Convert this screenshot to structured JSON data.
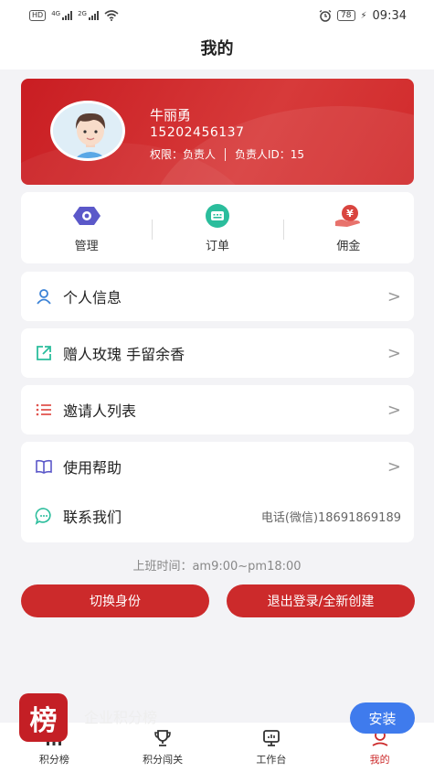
{
  "status_bar": {
    "left_badge": "HD",
    "net1": "4G",
    "net2": "2G",
    "battery": "78",
    "time": "09:34"
  },
  "navbar": {
    "title": "我的"
  },
  "profile": {
    "name": "牛丽勇",
    "phone": "15202456137",
    "permission": "权限：负责人",
    "manager_id": "负责人ID：15"
  },
  "quick_actions": [
    {
      "label": "管理",
      "icon": "manage-icon",
      "color": "#5b58c9"
    },
    {
      "label": "订单",
      "icon": "order-icon",
      "color": "#2bbd9c"
    },
    {
      "label": "佣金",
      "icon": "commission-icon",
      "color": "#d9453f"
    }
  ],
  "menu": {
    "personal_info": "个人信息",
    "gift_roses": "赠人玫瑰 手留余香",
    "invitee_list": "邀请人列表",
    "help": "使用帮助",
    "contact": "联系我们",
    "contact_phone": "电话(微信)18691869189",
    "chevron": ">"
  },
  "work_hours": "上班时间：am9:00~pm18:00",
  "buttons": {
    "switch_identity": "切换身份",
    "logout_create": "退出登录/全新创建"
  },
  "promo": {
    "logo_char": "榜",
    "text": "企业积分榜",
    "install": "安装"
  },
  "tabs": [
    {
      "label": "积分榜",
      "icon": "ranking-icon"
    },
    {
      "label": "积分闯关",
      "icon": "trophy-icon"
    },
    {
      "label": "工作台",
      "icon": "workbench-icon"
    },
    {
      "label": "我的",
      "icon": "profile-icon",
      "active": true
    }
  ],
  "colors": {
    "brand_red": "#cc2a2b",
    "install_blue": "#3f7bed"
  }
}
